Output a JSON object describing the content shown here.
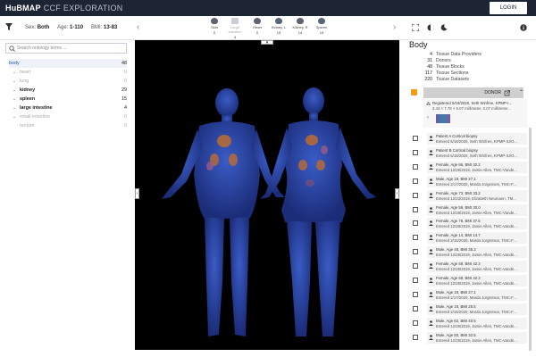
{
  "header": {
    "brand": "HuBMAP",
    "subtitle": "CCF EXPLORATION",
    "login_label": "LOGIN"
  },
  "toolbar": {
    "sex_label": "Sex:",
    "sex_value": "Both",
    "age_label": "Age:",
    "age_value": "1-110",
    "bmi_label": "BMI:",
    "bmi_value": "13-83",
    "organs": [
      {
        "label": "Skin",
        "count": "0"
      },
      {
        "label": "Large Intestine",
        "count": "4"
      },
      {
        "label": "Heart",
        "count": "0"
      },
      {
        "label": "Kidney, L",
        "count": "15"
      },
      {
        "label": "Kidney, R",
        "count": "14"
      },
      {
        "label": "Spleen",
        "count": "15"
      }
    ]
  },
  "left": {
    "search_placeholder": "Search ontology terms ...",
    "tree": [
      {
        "label": "body",
        "count": "48"
      },
      {
        "label": "heart",
        "count": "0"
      },
      {
        "label": "lung",
        "count": "0"
      },
      {
        "label": "kidney",
        "count": "29"
      },
      {
        "label": "spleen",
        "count": "15"
      },
      {
        "label": "large intestine",
        "count": "4"
      },
      {
        "label": "small intestine",
        "count": "0"
      },
      {
        "label": "rectum",
        "count": "0"
      }
    ]
  },
  "right": {
    "title": "Body",
    "stats": [
      {
        "n": "4",
        "t": "Tissue Data Providers"
      },
      {
        "n": "31",
        "t": "Donors"
      },
      {
        "n": "48",
        "t": "Tissue Blocks"
      },
      {
        "n": "117",
        "t": "Tissue Sections"
      },
      {
        "n": "220",
        "t": "Tissue Datasets"
      }
    ],
    "donor_label": "DONOR",
    "registered": {
      "line1": "Registered 5/18/2020, Seth Winfree, KPMP-I...",
      "line2": "3.44 × 7.78 × 5.07 millimeter, 0.07 millimeter..."
    },
    "rows": [
      {
        "l1": "Patient A Cortical biopsy",
        "l2": "Entered 5/18/2020, Seth Winfree, KPMP-IU/O..."
      },
      {
        "l1": "Patient B Cortical biopsy",
        "l2": "Entered 5/18/2020, Seth Winfree, KPMP-IU/O..."
      },
      {
        "l1": "Female, Age 66, BMI 32.2",
        "l2": "Entered 12/28/2019, Jamie Allen, TMC-Vande..."
      },
      {
        "l1": "Male, Age 18, BMI 27.1",
        "l2": "Entered 2/17/2020, Marda Jorgensen, TMC-F..."
      },
      {
        "l1": "Female, Age 73, BMI 33.2",
        "l2": "Entered 12/23/2019, Elizabeth Neumann, TM..."
      },
      {
        "l1": "Female, Age 59, BMI 30.0",
        "l2": "Entered 12/28/2019, Jamie Allen, TMC-Vande..."
      },
      {
        "l1": "Female, Age 76, BMI 37.5",
        "l2": "Entered 12/28/2019, Jamie Allen, TMC-Vande..."
      },
      {
        "l1": "Female, Age 14, BMI 14.7",
        "l2": "Entered 2/15/2020, Marda Jorgensen, TMC-F..."
      },
      {
        "l1": "Male, Age 48, BMI 35.3",
        "l2": "Entered 12/28/2019, Jamie Allen, TMC-Vande..."
      },
      {
        "l1": "Female, Age 58, BMI 42.3",
        "l2": "Entered 12/28/2019, Jamie Allen, TMC-Vande..."
      },
      {
        "l1": "Female, Age 58, BMI 42.3",
        "l2": "Entered 12/28/2019, Jamie Allen, TMC-Vande..."
      },
      {
        "l1": "Male, Age 18, BMI 27.1",
        "l2": "Entered 2/17/2020, Marda Jorgensen, TMC-F..."
      },
      {
        "l1": "Male, Age 18, BMI 25.5",
        "l2": "Entered 2/15/2020, Marda Jorgensen, TMC-F..."
      },
      {
        "l1": "Male, Age 62, BMI 40.5",
        "l2": "Entered 12/28/2019, Jamie Allen, TMC-Vande..."
      },
      {
        "l1": "Male, Age 50, BMI 32.5",
        "l2": "Entered 12/28/2019, Jamie Allen, TMC-Vande..."
      }
    ]
  }
}
